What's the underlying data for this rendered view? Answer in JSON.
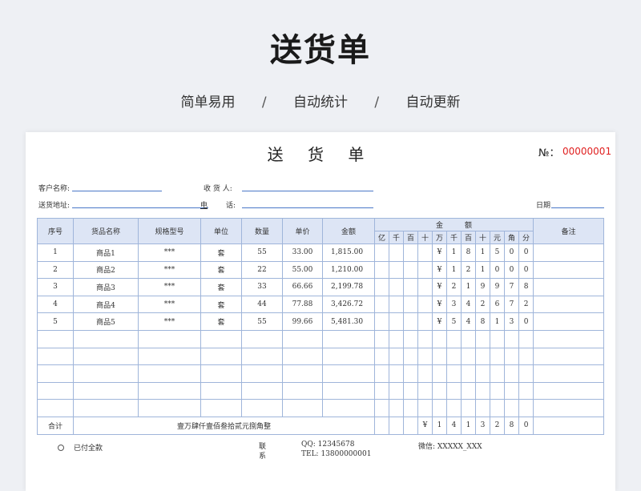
{
  "hero": {
    "title": "送货单",
    "features": [
      "简单易用",
      "自动统计",
      "自动更新"
    ],
    "separator": "/"
  },
  "form": {
    "title": "送 货 单",
    "no_label": "№：",
    "no_value": "00000001",
    "customer_label": "客户名称:",
    "receiver_label": "收 货 人:",
    "address_label": "送货地址:",
    "phone_label_a": "电",
    "phone_label_b": "话:",
    "date_label": "日期"
  },
  "table": {
    "headers": {
      "seq": "序号",
      "name": "货品名称",
      "spec": "规格型号",
      "unit": "单位",
      "qty": "数量",
      "price": "单价",
      "amount": "金额",
      "amount_group": "金　　　额",
      "remark": "备注",
      "digits": [
        "亿",
        "千",
        "百",
        "十",
        "万",
        "千",
        "百",
        "十",
        "元",
        "角",
        "分"
      ]
    },
    "rows": [
      {
        "seq": "1",
        "name": "商品1",
        "spec": "***",
        "unit": "套",
        "qty": "55",
        "price": "33.00",
        "amount": "1,815.00",
        "digits": [
          "",
          "",
          "",
          "",
          "¥",
          "1",
          "8",
          "1",
          "5",
          "0",
          "0"
        ],
        "remark": ""
      },
      {
        "seq": "2",
        "name": "商品2",
        "spec": "***",
        "unit": "套",
        "qty": "22",
        "price": "55.00",
        "amount": "1,210.00",
        "digits": [
          "",
          "",
          "",
          "",
          "¥",
          "1",
          "2",
          "1",
          "0",
          "0",
          "0"
        ],
        "remark": ""
      },
      {
        "seq": "3",
        "name": "商品3",
        "spec": "***",
        "unit": "套",
        "qty": "33",
        "price": "66.66",
        "amount": "2,199.78",
        "digits": [
          "",
          "",
          "",
          "",
          "¥",
          "2",
          "1",
          "9",
          "9",
          "7",
          "8"
        ],
        "remark": ""
      },
      {
        "seq": "4",
        "name": "商品4",
        "spec": "***",
        "unit": "套",
        "qty": "44",
        "price": "77.88",
        "amount": "3,426.72",
        "digits": [
          "",
          "",
          "",
          "",
          "¥",
          "3",
          "4",
          "2",
          "6",
          "7",
          "2"
        ],
        "remark": ""
      },
      {
        "seq": "5",
        "name": "商品5",
        "spec": "***",
        "unit": "套",
        "qty": "55",
        "price": "99.66",
        "amount": "5,481.30",
        "digits": [
          "",
          "",
          "",
          "",
          "¥",
          "5",
          "4",
          "8",
          "1",
          "3",
          "0"
        ],
        "remark": ""
      }
    ],
    "empty_rows": 5,
    "total": {
      "label": "合计",
      "words": "壹万肆仟壹佰叁拾贰元捌角整",
      "digits": [
        "",
        "",
        "",
        "¥",
        "1",
        "4",
        "1",
        "3",
        "2",
        "8",
        "0"
      ]
    }
  },
  "footer": {
    "paid_label": "已付全款",
    "contact_label_1": "联",
    "contact_label_2": "系",
    "qq": "QQ: 12345678",
    "tel": "TEL: 13800000001",
    "wechat": "微信: XXXXX_XXX"
  }
}
